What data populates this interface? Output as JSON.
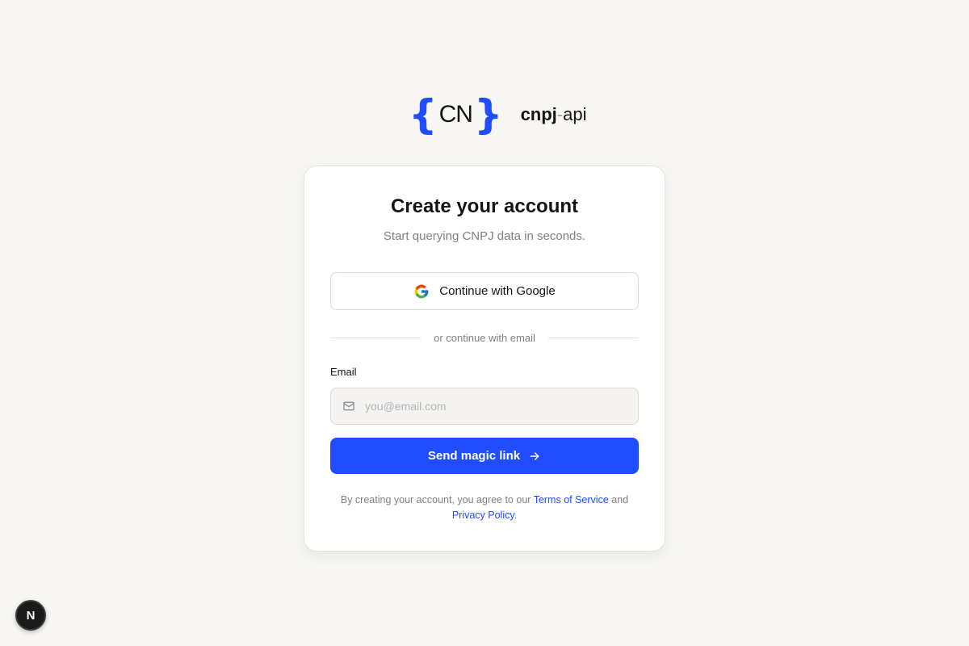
{
  "brand": {
    "mark_open": "{",
    "mark_letters": "CN",
    "mark_close": "}",
    "word_strong": "cnpj",
    "word_dash": "-",
    "word_light": "api",
    "accent": "#1f4dff"
  },
  "card": {
    "title": "Create your account",
    "subtitle": "Start querying CNPJ data in seconds.",
    "google_button_label": "Continue with Google",
    "divider_text": "or continue with email",
    "email_label": "Email",
    "email_placeholder": "you@email.com",
    "email_value": "",
    "submit_label": "Send magic link",
    "legal_prefix": "By creating your account, you agree to our ",
    "terms_link": "Terms of Service",
    "legal_and": " and",
    "privacy_link": "Privacy Policy",
    "legal_suffix": "."
  },
  "icons": {
    "google": "google-icon",
    "mail": "mail-icon",
    "arrow": "arrow-right-icon"
  },
  "badge": {
    "label": "N"
  }
}
